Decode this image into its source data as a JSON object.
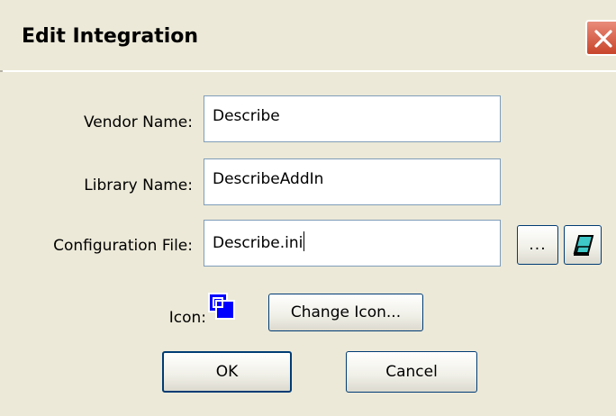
{
  "dialog": {
    "title": "Edit Integration"
  },
  "form": {
    "vendor_name_label": "Vendor Name:",
    "vendor_name_value": "Describe",
    "library_name_label": "Library Name:",
    "library_name_value": "DescribeAddIn",
    "config_file_label": "Configuration File:",
    "config_file_value": "Describe.ini",
    "browse_label": "...",
    "icon_label": "Icon:",
    "change_icon_label": "Change Icon..."
  },
  "buttons": {
    "ok_label": "OK",
    "cancel_label": "Cancel"
  },
  "icons": {
    "close": "close-icon",
    "edit_file": "edit-file-icon",
    "integration": "integration-icon"
  },
  "colors": {
    "dialog_bg": "#ece9d8",
    "close_button": "#c8442a",
    "icon_blue": "#0000ff"
  }
}
